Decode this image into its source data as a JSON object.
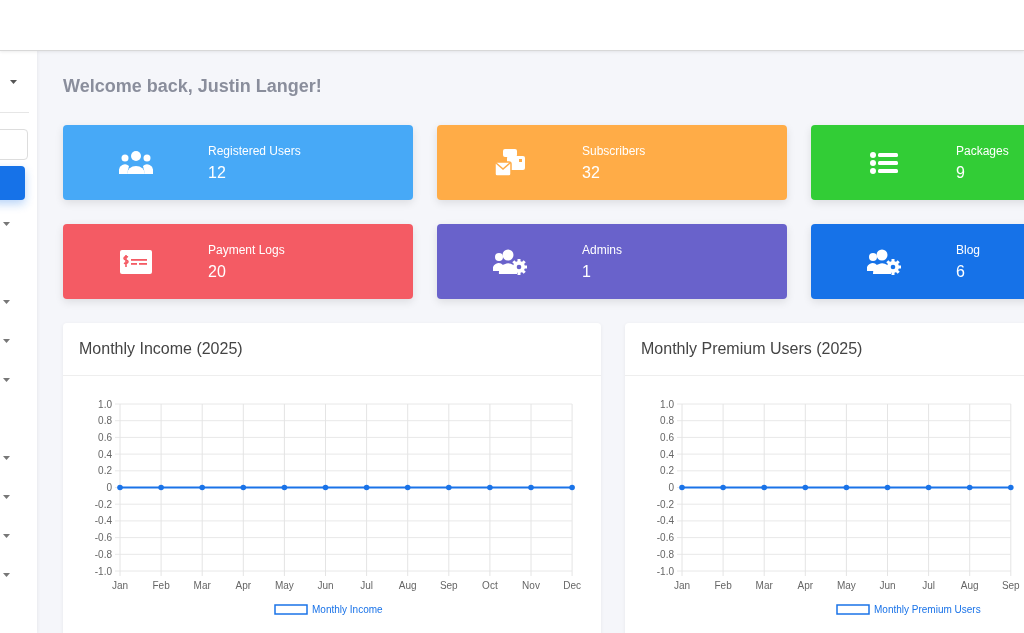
{
  "welcome": "Welcome back, Justin Langer!",
  "stats": [
    {
      "label": "Registered Users",
      "value": "12",
      "color": "#47a9f7"
    },
    {
      "label": "Subscribers",
      "value": "32",
      "color": "#ffac47"
    },
    {
      "label": "Packages",
      "value": "9",
      "color": "#32cd36"
    },
    {
      "label": "Payment Logs",
      "value": "20",
      "color": "#f45b64"
    },
    {
      "label": "Admins",
      "value": "1",
      "color": "#6962cb"
    },
    {
      "label": "Blog",
      "value": "6",
      "color": "#1672e8"
    }
  ],
  "charts": [
    {
      "title": "Monthly Income (2025)",
      "chart_data": {
        "type": "line",
        "categories": [
          "Jan",
          "Feb",
          "Mar",
          "Apr",
          "May",
          "Jun",
          "Jul",
          "Aug",
          "Sep",
          "Oct",
          "Nov",
          "Dec"
        ],
        "grid": true,
        "series": [
          {
            "name": "Monthly Income",
            "color": "#1a73e8",
            "values": [
              0,
              0,
              0,
              0,
              0,
              0,
              0,
              0,
              0,
              0,
              0,
              0
            ]
          }
        ],
        "ylim": [
          -1,
          1
        ],
        "yticks": [
          {
            "value": 1,
            "label": "1.0"
          },
          {
            "value": 0.8,
            "label": "0.8"
          },
          {
            "value": 0.6,
            "label": "0.6"
          },
          {
            "value": 0.4,
            "label": "0.4"
          },
          {
            "value": 0.2,
            "label": "0.2"
          },
          {
            "value": 0,
            "label": "0"
          },
          {
            "value": -0.2,
            "label": "-0.2"
          },
          {
            "value": -0.4,
            "label": "-0.4"
          },
          {
            "value": -0.6,
            "label": "-0.6"
          },
          {
            "value": -0.8,
            "label": "-0.8"
          },
          {
            "value": -1,
            "label": "-1.0"
          }
        ]
      }
    },
    {
      "title": "Monthly Premium Users (2025)",
      "chart_data": {
        "type": "line",
        "categories": [
          "Jan",
          "Feb",
          "Mar",
          "Apr",
          "May",
          "Jun",
          "Jul",
          "Aug",
          "Sep"
        ],
        "grid": true,
        "series": [
          {
            "name": "Monthly Premium Users",
            "color": "#1a73e8",
            "values": [
              0,
              0,
              0,
              0,
              0,
              0,
              0,
              0,
              0
            ]
          }
        ],
        "ylim": [
          -1,
          1
        ],
        "yticks": [
          {
            "value": 1,
            "label": "1.0"
          },
          {
            "value": 0.8,
            "label": "0.8"
          },
          {
            "value": 0.6,
            "label": "0.6"
          },
          {
            "value": 0.4,
            "label": "0.4"
          },
          {
            "value": 0.2,
            "label": "0.2"
          },
          {
            "value": 0,
            "label": "0"
          },
          {
            "value": -0.2,
            "label": "-0.2"
          },
          {
            "value": -0.4,
            "label": "-0.4"
          },
          {
            "value": -0.6,
            "label": "-0.6"
          },
          {
            "value": -0.8,
            "label": "-0.8"
          },
          {
            "value": -1,
            "label": "-1.0"
          }
        ]
      }
    }
  ]
}
